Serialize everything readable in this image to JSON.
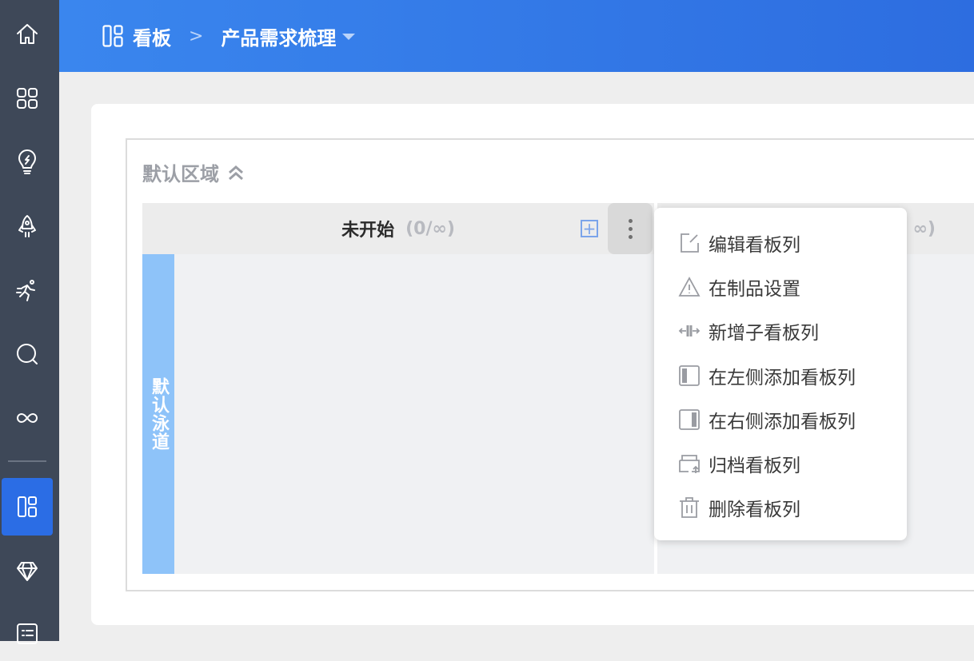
{
  "sidebar": {
    "items": [
      {
        "name": "home",
        "icon": "home-icon"
      },
      {
        "name": "apps",
        "icon": "grid-icon"
      },
      {
        "name": "ideas",
        "icon": "lightbulb-icon"
      },
      {
        "name": "release",
        "icon": "rocket-icon"
      },
      {
        "name": "sprint",
        "icon": "runner-icon"
      },
      {
        "name": "search",
        "icon": "search-icon"
      },
      {
        "name": "devops",
        "icon": "infinity-icon"
      },
      {
        "name": "kanban",
        "icon": "kanban-icon",
        "active": true
      },
      {
        "name": "product",
        "icon": "diamond-icon"
      },
      {
        "name": "list",
        "icon": "list-icon"
      }
    ]
  },
  "header": {
    "breadcrumb_root": "看板",
    "breadcrumb_current": "产品需求梳理"
  },
  "region": {
    "title": "默认区域"
  },
  "columns": [
    {
      "title": "未开始",
      "count": "(0/∞)"
    },
    {
      "title": "",
      "count": "∞)"
    }
  ],
  "lane": {
    "title": "默认泳道"
  },
  "menu": {
    "items": [
      {
        "label": "编辑看板列",
        "icon": "edit-icon"
      },
      {
        "label": "在制品设置",
        "icon": "warning-icon"
      },
      {
        "label": "新增子看板列",
        "icon": "split-column-icon"
      },
      {
        "label": "在左侧添加看板列",
        "icon": "insert-left-icon"
      },
      {
        "label": "在右侧添加看板列",
        "icon": "insert-right-icon"
      },
      {
        "label": "归档看板列",
        "icon": "archive-icon"
      },
      {
        "label": "删除看板列",
        "icon": "trash-icon"
      }
    ]
  },
  "colors": {
    "sidebar": "#3e4858",
    "accent": "#2b6de5",
    "lane": "#8ec3f9"
  }
}
